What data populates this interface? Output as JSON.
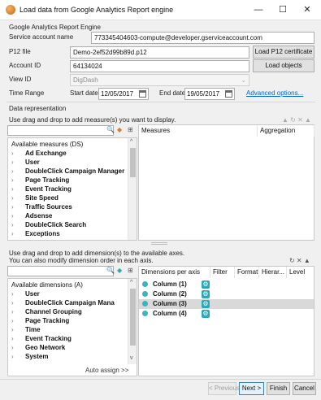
{
  "window": {
    "title": "Load data from Google Analytics Report engine",
    "minimize": "—",
    "maximize": "☐",
    "close": "✕"
  },
  "ga_section": {
    "title": "Google Analytics Report Engine",
    "service_account_label": "Service account name",
    "service_account_value": "773345404603-compute@developer.gserviceaccount.com",
    "p12_label": "P12 file",
    "p12_value": "Demo-2ef52d99b89d.p12",
    "p12_button": "Load P12 certificate",
    "account_label": "Account ID",
    "account_value": "64134024",
    "load_objects_button": "Load objects",
    "view_label": "View ID",
    "view_value": "DigDash",
    "time_range_label": "Time Range",
    "start_label": "Start date:",
    "start_value": "12/05/2017",
    "end_label": "End date:",
    "end_value": "19/05/2017",
    "advanced_link": "Advanced options..."
  },
  "data_rep": {
    "title": "Data representation",
    "measures_hint": "Use drag and drop to add measure(s) you want to display.",
    "measures_tree_root": "Available measures (DS)",
    "measures_items": [
      "Ad Exchange",
      "User",
      "DoubleClick Campaign Manager",
      "Page Tracking",
      "Event Tracking",
      "Site Speed",
      "Traffic Sources",
      "Adsense",
      "DoubleClick Search",
      "Exceptions"
    ],
    "measures_col": "Measures",
    "aggregation_col": "Aggregation",
    "dims_hint_1": "Use drag and drop to add dimension(s) to the available axes.",
    "dims_hint_2": "You can also modify dimension order in each axis.",
    "dims_tree_root": "Available dimensions (A)",
    "dims_items": [
      "User",
      "DoubleClick Campaign Mana",
      "Channel Grouping",
      "Page Tracking",
      "Time",
      "Event Tracking",
      "Geo Network",
      "System"
    ],
    "auto_assign": "Auto assign >>",
    "dims_columns": [
      "Dimensions per axis",
      "Filter",
      "Format",
      "Hierar...",
      "Level"
    ],
    "dims_rows": [
      "Column (1)",
      "Column (2)",
      "Column (3)",
      "Column (4)"
    ]
  },
  "footer": {
    "previous": "< Previous",
    "next": "Next >",
    "finish": "Finish",
    "cancel": "Cancel"
  }
}
